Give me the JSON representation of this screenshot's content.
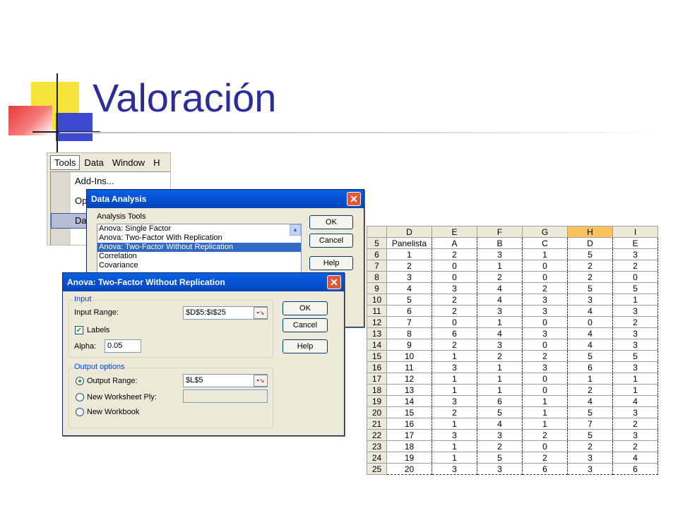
{
  "slide": {
    "title": "Valoración"
  },
  "menu": {
    "bar": [
      "Tools",
      "Data",
      "Window",
      "H"
    ],
    "items": [
      "Add-Ins...",
      "Op",
      "Da"
    ]
  },
  "data_analysis": {
    "title": "Data Analysis",
    "section_label": "Analysis Tools",
    "tools": [
      "Anova: Single Factor",
      "Anova: Two-Factor With Replication",
      "Anova: Two-Factor Without Replication",
      "Correlation",
      "Covariance"
    ],
    "selected_tool": "Anova: Two-Factor Without Replication",
    "buttons": {
      "ok": "OK",
      "cancel": "Cancel",
      "help": "Help"
    }
  },
  "anova_dialog": {
    "title": "Anova: Two-Factor Without Replication",
    "input_group": "Input",
    "input_range_label": "Input Range:",
    "input_range_value": "$D$5:$I$25",
    "labels_label": "Labels",
    "labels_checked": true,
    "alpha_label": "Alpha:",
    "alpha_value": "0.05",
    "output_group": "Output options",
    "output_range_label": "Output Range:",
    "output_range_value": "$L$5",
    "new_ply_label": "New Worksheet Ply:",
    "new_workbook_label": "New Workbook",
    "selected_output": "Output Range",
    "buttons": {
      "ok": "OK",
      "cancel": "Cancel",
      "help": "Help"
    }
  },
  "sheet": {
    "columns": [
      "D",
      "E",
      "F",
      "G",
      "H",
      "I"
    ],
    "highlighted_column": "H",
    "rows": [
      {
        "num": "5",
        "cells": [
          "Panelista",
          "A",
          "B",
          "C",
          "D",
          "E"
        ]
      },
      {
        "num": "6",
        "cells": [
          "1",
          "2",
          "3",
          "1",
          "5",
          "3"
        ]
      },
      {
        "num": "7",
        "cells": [
          "2",
          "0",
          "1",
          "0",
          "2",
          "2"
        ]
      },
      {
        "num": "8",
        "cells": [
          "3",
          "0",
          "2",
          "0",
          "2",
          "0"
        ]
      },
      {
        "num": "9",
        "cells": [
          "4",
          "3",
          "4",
          "2",
          "5",
          "5"
        ]
      },
      {
        "num": "10",
        "cells": [
          "5",
          "2",
          "4",
          "3",
          "3",
          "1"
        ]
      },
      {
        "num": "11",
        "cells": [
          "6",
          "2",
          "3",
          "3",
          "4",
          "3"
        ]
      },
      {
        "num": "12",
        "cells": [
          "7",
          "0",
          "1",
          "0",
          "0",
          "2"
        ]
      },
      {
        "num": "13",
        "cells": [
          "8",
          "6",
          "4",
          "3",
          "4",
          "3"
        ]
      },
      {
        "num": "14",
        "cells": [
          "9",
          "2",
          "3",
          "0",
          "4",
          "3"
        ]
      },
      {
        "num": "15",
        "cells": [
          "10",
          "1",
          "2",
          "2",
          "5",
          "5"
        ]
      },
      {
        "num": "16",
        "cells": [
          "11",
          "3",
          "1",
          "3",
          "6",
          "3"
        ]
      },
      {
        "num": "17",
        "cells": [
          "12",
          "1",
          "1",
          "0",
          "1",
          "1"
        ]
      },
      {
        "num": "18",
        "cells": [
          "13",
          "1",
          "1",
          "0",
          "2",
          "1"
        ]
      },
      {
        "num": "19",
        "cells": [
          "14",
          "3",
          "6",
          "1",
          "4",
          "4"
        ]
      },
      {
        "num": "20",
        "cells": [
          "15",
          "2",
          "5",
          "1",
          "5",
          "3"
        ]
      },
      {
        "num": "21",
        "cells": [
          "16",
          "1",
          "4",
          "1",
          "7",
          "2"
        ]
      },
      {
        "num": "22",
        "cells": [
          "17",
          "3",
          "3",
          "2",
          "5",
          "3"
        ]
      },
      {
        "num": "23",
        "cells": [
          "18",
          "1",
          "2",
          "0",
          "2",
          "2"
        ]
      },
      {
        "num": "24",
        "cells": [
          "19",
          "1",
          "5",
          "2",
          "3",
          "4"
        ]
      },
      {
        "num": "25",
        "cells": [
          "20",
          "3",
          "3",
          "6",
          "3",
          "6"
        ]
      }
    ]
  }
}
